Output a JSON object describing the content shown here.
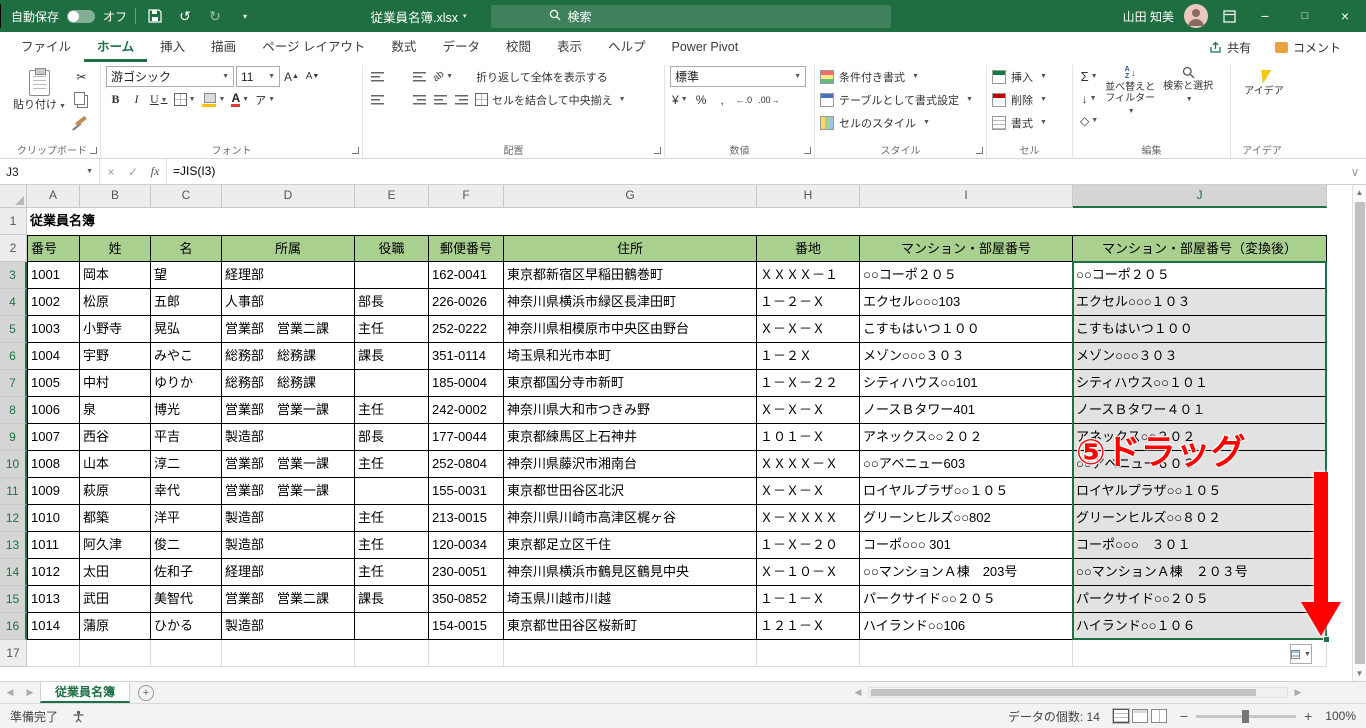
{
  "title_bar": {
    "autosave_label": "自動保存",
    "autosave_state": "オフ",
    "filename": "従業員名簿.xlsx",
    "search_placeholder": "検索",
    "user_name": "山田 知美"
  },
  "ribbon": {
    "tabs": [
      "ファイル",
      "ホーム",
      "挿入",
      "描画",
      "ページ レイアウト",
      "数式",
      "データ",
      "校閲",
      "表示",
      "ヘルプ",
      "Power Pivot"
    ],
    "active_tab": "ホーム",
    "share_label": "共有",
    "comments_label": "コメント",
    "groups": {
      "clipboard": {
        "label": "クリップボード",
        "paste": "貼り付け"
      },
      "font": {
        "label": "フォント",
        "font_name": "游ゴシック",
        "font_size": "11"
      },
      "alignment": {
        "label": "配置",
        "wrap": "折り返して全体を表示する",
        "merge": "セルを結合して中央揃え"
      },
      "number": {
        "label": "数値",
        "format": "標準"
      },
      "styles": {
        "label": "スタイル",
        "items": [
          "条件付き書式",
          "テーブルとして書式設定",
          "セルのスタイル"
        ]
      },
      "cells": {
        "label": "セル",
        "items": [
          "挿入",
          "削除",
          "書式"
        ]
      },
      "editing": {
        "label": "編集",
        "items": [
          "並べ替えとフィルター",
          "検索と選択"
        ]
      },
      "ideas": {
        "label": "アイデア",
        "button": "アイデア"
      }
    }
  },
  "formula_bar": {
    "name_box": "J3",
    "formula": "=JIS(I3)"
  },
  "sheet": {
    "column_letters": [
      "A",
      "B",
      "C",
      "D",
      "E",
      "F",
      "G",
      "H",
      "I",
      "J"
    ],
    "row_count": 17,
    "title_row": {
      "number": 1,
      "text": "従業員名簿"
    },
    "header_row": {
      "number": 2,
      "cells": [
        "番号",
        "姓",
        "名",
        "所属",
        "役職",
        "郵便番号",
        "住所",
        "番地",
        "マンション・部屋番号",
        "マンション・部屋番号（変換後）"
      ]
    },
    "data_rows": [
      {
        "number": 3,
        "cells": [
          "1001",
          "岡本",
          "望",
          "経理部",
          "",
          "162-0041",
          "東京都新宿区早稲田鶴巻町",
          "ＸＸＸＸ－１",
          "○○コーポ２０５",
          "○○コーポ２０５"
        ]
      },
      {
        "number": 4,
        "cells": [
          "1002",
          "松原",
          "五郎",
          "人事部",
          "部長",
          "226-0026",
          "神奈川県横浜市緑区長津田町",
          "１－２－Ｘ",
          "エクセル○○○103",
          "エクセル○○○１０３"
        ]
      },
      {
        "number": 5,
        "cells": [
          "1003",
          "小野寺",
          "晃弘",
          "営業部　営業二課",
          "主任",
          "252-0222",
          "神奈川県相模原市中央区由野台",
          "Ｘ－Ｘ－Ｘ",
          "こすもはいつ１００",
          "こすもはいつ１００"
        ]
      },
      {
        "number": 6,
        "cells": [
          "1004",
          "宇野",
          "みやこ",
          "総務部　総務課",
          "課長",
          "351-0114",
          "埼玉県和光市本町",
          "１－２Ｘ",
          "メゾン○○○３０３",
          "メゾン○○○３０３"
        ]
      },
      {
        "number": 7,
        "cells": [
          "1005",
          "中村",
          "ゆりか",
          "総務部　総務課",
          "",
          "185-0004",
          "東京都国分寺市新町",
          "１－Ｘ－２２",
          "シティハウス○○101",
          "シティハウス○○１０１"
        ]
      },
      {
        "number": 8,
        "cells": [
          "1006",
          "泉",
          "博光",
          "営業部　営業一課",
          "主任",
          "242-0002",
          "神奈川県大和市つきみ野",
          "Ｘ－Ｘ－Ｘ",
          "ノースＢタワー401",
          "ノースＢタワー４０１"
        ]
      },
      {
        "number": 9,
        "cells": [
          "1007",
          "西谷",
          "平吉",
          "製造部",
          "部長",
          "177-0044",
          "東京都練馬区上石神井",
          "１０１－Ｘ",
          "アネックス○○２０２",
          "アネックス○○２０２"
        ]
      },
      {
        "number": 10,
        "cells": [
          "1008",
          "山本",
          "淳二",
          "営業部　営業一課",
          "主任",
          "252-0804",
          "神奈川県藤沢市湘南台",
          "ＸＸＸＸ－Ｘ",
          "○○アベニュー603",
          "○○アベニュー６０３"
        ]
      },
      {
        "number": 11,
        "cells": [
          "1009",
          "萩原",
          "幸代",
          "営業部　営業一課",
          "",
          "155-0031",
          "東京都世田谷区北沢",
          "Ｘ－Ｘ－Ｘ",
          "ロイヤルプラザ○○１０５",
          "ロイヤルプラザ○○１０５"
        ]
      },
      {
        "number": 12,
        "cells": [
          "1010",
          "都築",
          "洋平",
          "製造部",
          "主任",
          "213-0015",
          "神奈川県川崎市高津区梶ヶ谷",
          "Ｘ－ＸＸＸＸ",
          "グリーンヒルズ○○802",
          "グリーンヒルズ○○８０２"
        ]
      },
      {
        "number": 13,
        "cells": [
          "1011",
          "阿久津",
          "俊二",
          "製造部",
          "主任",
          "120-0034",
          "東京都足立区千住",
          "１－Ｘ－２０",
          "コーポ○○○ 301",
          "コーポ○○○　３０１"
        ]
      },
      {
        "number": 14,
        "cells": [
          "1012",
          "太田",
          "佐和子",
          "経理部",
          "主任",
          "230-0051",
          "神奈川県横浜市鶴見区鶴見中央",
          "Ｘ－１０－Ｘ",
          "○○マンションＡ棟　203号",
          "○○マンションＡ棟　２０３号"
        ]
      },
      {
        "number": 15,
        "cells": [
          "1013",
          "武田",
          "美智代",
          "営業部　営業二課",
          "課長",
          "350-0852",
          "埼玉県川越市川越",
          "１－１－Ｘ",
          "パークサイド○○２０５",
          "パークサイド○○２０５"
        ]
      },
      {
        "number": 16,
        "cells": [
          "1014",
          "蒲原",
          "ひかる",
          "製造部",
          "",
          "154-0015",
          "東京都世田谷区桜新町",
          "１２１－Ｘ",
          "ハイランド○○106",
          "ハイランド○○１０６"
        ]
      }
    ],
    "empty_row_number": 17,
    "selection": {
      "active_cell": "J3",
      "range": "J3:J16",
      "selected_column": "J"
    },
    "colors": {
      "header_fill": "#A9D08E",
      "selection_fill": "#E2E2E2",
      "accent_green": "#1E7145",
      "titlebar_green": "#1E6E41"
    }
  },
  "annotation": {
    "step_label": "⑤ドラッグ",
    "color": "#FF0000"
  },
  "sheet_tabs": {
    "active": "従業員名簿"
  },
  "status_bar": {
    "mode": "準備完了",
    "count": "データの個数: 14",
    "zoom": "100%"
  }
}
